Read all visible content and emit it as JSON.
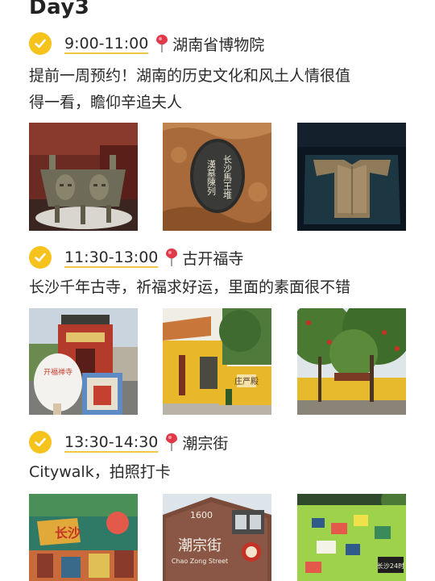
{
  "day": {
    "title": "Day3"
  },
  "stops": [
    {
      "time": "9:00-11:00",
      "place": "湖南省博物院",
      "desc_line1": "提前一周预约！湖南的历史文化和风土人情很值",
      "desc_line2": "得一看，瞻仰辛追夫人"
    },
    {
      "time": "11:30-13:00",
      "place": "古开福寺",
      "desc_line1": "长沙千年古寺，祈福求好运，里面的素面很不错"
    },
    {
      "time": "13:30-14:30",
      "place": "潮宗街",
      "desc_line1": "Citywalk，拍照打卡"
    }
  ],
  "photo_text": {
    "tablet": "长沙馬王堆",
    "tablet2": "漢墓陳列",
    "fan": "开福禅寺",
    "hall_plaque": "庄严殿",
    "changsha": "长沙",
    "street_number": "1600",
    "street_name": "潮宗街",
    "street_en": "Chao Zong Street",
    "board_sign": "长沙24时"
  },
  "colors": {
    "accent": "#f6c21c",
    "pin": "#e0394a"
  },
  "icons": {
    "check": "check-circle-icon",
    "pin": "map-pin-icon"
  }
}
